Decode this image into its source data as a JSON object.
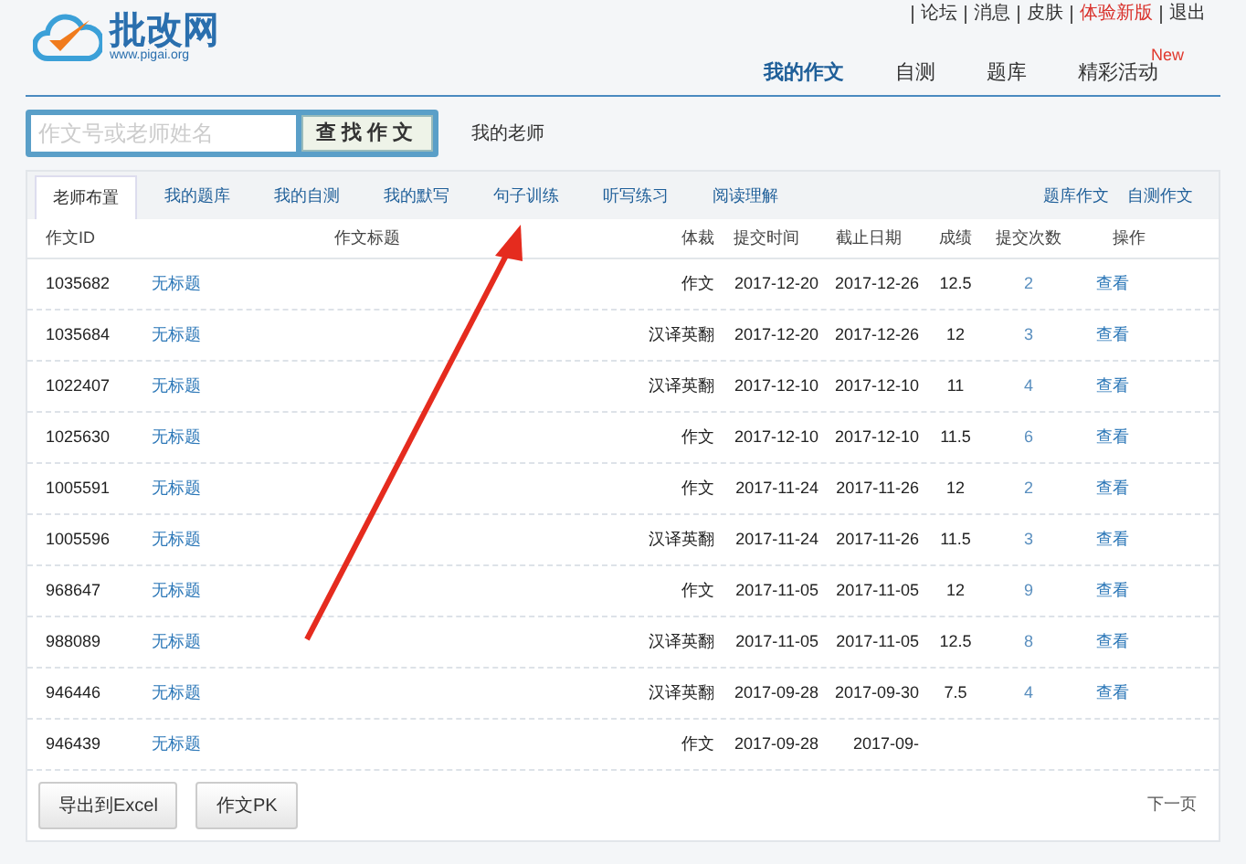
{
  "logo": {
    "name": "批改网",
    "url": "www.pigai.org"
  },
  "top_links": [
    {
      "label": "论坛",
      "highlight": false
    },
    {
      "label": "消息",
      "highlight": false
    },
    {
      "label": "皮肤",
      "highlight": false
    },
    {
      "label": "体验新版",
      "highlight": true
    },
    {
      "label": "退出",
      "highlight": false
    }
  ],
  "nav": [
    {
      "label": "我的作文",
      "selected": true
    },
    {
      "label": "自测",
      "selected": false
    },
    {
      "label": "题库",
      "selected": false
    },
    {
      "label": "精彩活动",
      "selected": false,
      "badge": "New"
    }
  ],
  "search": {
    "placeholder": "作文号或老师姓名",
    "button": "查找作文"
  },
  "teacher_label": "我的老师",
  "tabs": [
    {
      "label": "老师布置",
      "selected": true
    },
    {
      "label": "我的题库",
      "selected": false
    },
    {
      "label": "我的自测",
      "selected": false
    },
    {
      "label": "我的默写",
      "selected": false
    },
    {
      "label": "句子训练",
      "selected": false
    },
    {
      "label": "听写练习",
      "selected": false
    },
    {
      "label": "阅读理解",
      "selected": false
    }
  ],
  "tab_links": [
    "题库作文",
    "自测作文"
  ],
  "table": {
    "columns": [
      "作文ID",
      "作文标题",
      "体裁",
      "提交时间",
      "截止日期",
      "成绩",
      "提交次数",
      "操作"
    ],
    "rows": [
      {
        "id": "1035682",
        "title": "无标题",
        "genre": "作文",
        "submitted": "2017-12-20",
        "deadline": "2017-12-26",
        "score": "12.5",
        "count": "2",
        "action": "查看"
      },
      {
        "id": "1035684",
        "title": "无标题",
        "genre": "汉译英翻",
        "submitted": "2017-12-20",
        "deadline": "2017-12-26",
        "score": "12",
        "count": "3",
        "action": "查看"
      },
      {
        "id": "1022407",
        "title": "无标题",
        "genre": "汉译英翻",
        "submitted": "2017-12-10",
        "deadline": "2017-12-10",
        "score": "11",
        "count": "4",
        "action": "查看"
      },
      {
        "id": "1025630",
        "title": "无标题",
        "genre": "作文",
        "submitted": "2017-12-10",
        "deadline": "2017-12-10",
        "score": "11.5",
        "count": "6",
        "action": "查看"
      },
      {
        "id": "1005591",
        "title": "无标题",
        "genre": "作文",
        "submitted": "2017-11-24",
        "deadline": "2017-11-26",
        "score": "12",
        "count": "2",
        "action": "查看"
      },
      {
        "id": "1005596",
        "title": "无标题",
        "genre": "汉译英翻",
        "submitted": "2017-11-24",
        "deadline": "2017-11-26",
        "score": "11.5",
        "count": "3",
        "action": "查看"
      },
      {
        "id": "968647",
        "title": "无标题",
        "genre": "作文",
        "submitted": "2017-11-05",
        "deadline": "2017-11-05",
        "score": "12",
        "count": "9",
        "action": "查看"
      },
      {
        "id": "988089",
        "title": "无标题",
        "genre": "汉译英翻",
        "submitted": "2017-11-05",
        "deadline": "2017-11-05",
        "score": "12.5",
        "count": "8",
        "action": "查看"
      },
      {
        "id": "946446",
        "title": "无标题",
        "genre": "汉译英翻",
        "submitted": "2017-09-28",
        "deadline": "2017-09-30",
        "score": "7.5",
        "count": "4",
        "action": "查看"
      },
      {
        "id": "946439",
        "title": "无标题",
        "genre": "作文",
        "submitted": "2017-09-28",
        "deadline": "2017-09-"
      }
    ]
  },
  "buttons": [
    "导出到Excel",
    "作文PK"
  ],
  "pagination": {
    "next": "下一页"
  }
}
